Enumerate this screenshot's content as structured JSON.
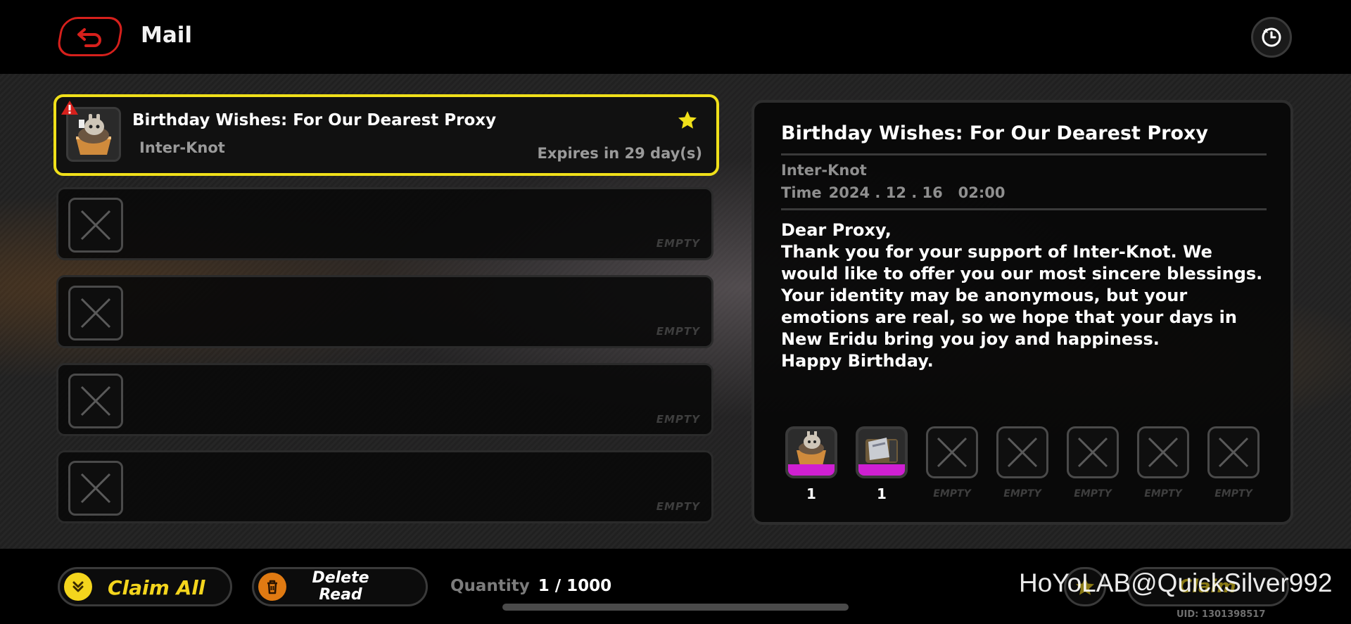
{
  "header": {
    "title": "Mail"
  },
  "mail_list": {
    "selected": {
      "title": "Birthday Wishes: For Our Dearest Proxy",
      "sender": "Inter-Knot",
      "expiry": "Expires in 29 day(s)"
    },
    "empty_label": "EMPTY",
    "empty_slot_count": 4
  },
  "detail": {
    "title": "Birthday Wishes: For Our Dearest Proxy",
    "sender": "Inter-Knot",
    "time_label": "Time",
    "time_value": "2024 . 12 . 16   02:00",
    "body": [
      "Dear Proxy,",
      "Thank you for your support of Inter-Knot. We would like to offer you our most sincere blessings.",
      "Your identity may be anonymous, but your emotions are real, so we hope that your days in New Eridu bring you joy and happiness.",
      "Happy Birthday."
    ],
    "rewards": [
      {
        "icon": "bangboo-cake-icon",
        "count": "1"
      },
      {
        "icon": "gear-chest-icon",
        "count": "1"
      },
      {
        "empty": "EMPTY"
      },
      {
        "empty": "EMPTY"
      },
      {
        "empty": "EMPTY"
      },
      {
        "empty": "EMPTY"
      },
      {
        "empty": "EMPTY"
      }
    ]
  },
  "footer": {
    "claim_all": "Claim All",
    "delete_read": "Delete Read",
    "quantity_label": "Quantity",
    "quantity_value": "1 / 1000",
    "claim_label": "Claim",
    "uid": "UID: 1301398517"
  },
  "watermark": "HoYoLAB@QuickSilver992",
  "colors": {
    "accent_yellow": "#f0e01a",
    "back_red": "#d6201c",
    "rarity_purple": "#cf1fd2",
    "claim_orange": "#e07a12"
  }
}
